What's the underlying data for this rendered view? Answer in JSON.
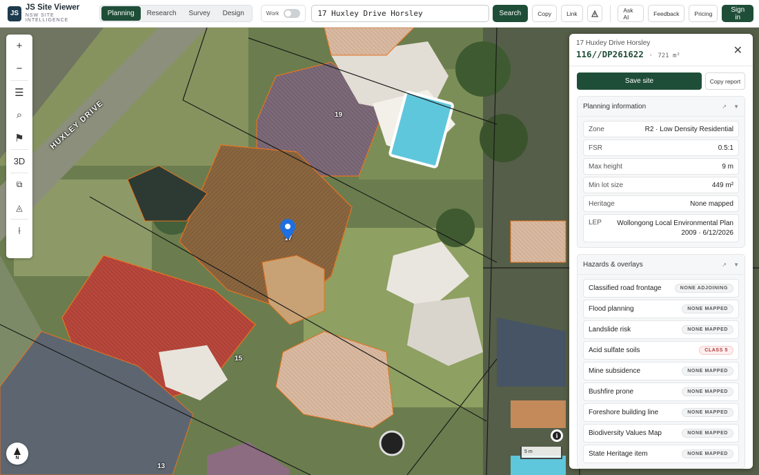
{
  "header": {
    "logo": "JS",
    "title": "JS Site Viewer",
    "subtitle": "NSW SITE INTELLIGENCE",
    "modes": [
      "Planning",
      "Research",
      "Survey",
      "Design"
    ],
    "active_mode": "Planning",
    "work_label": "Work",
    "search_value": "17 Huxley Drive Horsley",
    "search_button": "Search",
    "copy_button": "Copy",
    "link_button": "Link",
    "ask_ai": "Ask AI",
    "feedback": "Feedback",
    "pricing": "Pricing",
    "sign_in": "Sign in"
  },
  "map": {
    "street_name": "HUXLEY DRIVE",
    "lot_labels": [
      "19",
      "17",
      "15",
      "13"
    ],
    "scale_label": "5 m",
    "compass_label": "N",
    "toolbar": [
      "zoom-in",
      "zoom-out",
      "layers",
      "search",
      "flag",
      "3D",
      "copy",
      "measure-area",
      "measure-line"
    ],
    "toolbar_3d_label": "3D"
  },
  "panel": {
    "address": "17 Huxley Drive Horsley",
    "lot": "116//DP261622",
    "area_sep": "·",
    "area": "721 m²",
    "save_button": "Save site",
    "copy_report_button": "Copy report",
    "planning": {
      "title": "Planning information",
      "rows": [
        {
          "key": "Zone",
          "value": "R2 · Low Density Residential"
        },
        {
          "key": "FSR",
          "value": "0.5:1"
        },
        {
          "key": "Max height",
          "value": "9 m"
        },
        {
          "key": "Min lot size",
          "value": "449 m²"
        },
        {
          "key": "Heritage",
          "value": "None mapped"
        },
        {
          "key": "LEP",
          "value": "Wollongong Local Environmental Plan 2009 · 6/12/2026"
        }
      ]
    },
    "hazards": {
      "title": "Hazards & overlays",
      "rows": [
        {
          "key": "Classified road frontage",
          "value": "NONE ADJOINING",
          "status": "neutral"
        },
        {
          "key": "Flood planning",
          "value": "NONE MAPPED",
          "status": "neutral"
        },
        {
          "key": "Landslide risk",
          "value": "NONE MAPPED",
          "status": "neutral"
        },
        {
          "key": "Acid sulfate soils",
          "value": "CLASS 5",
          "status": "warn"
        },
        {
          "key": "Mine subsidence",
          "value": "NONE MAPPED",
          "status": "neutral"
        },
        {
          "key": "Bushfire prone",
          "value": "NONE MAPPED",
          "status": "neutral"
        },
        {
          "key": "Foreshore building line",
          "value": "NONE MAPPED",
          "status": "neutral"
        },
        {
          "key": "Biodiversity Values Map",
          "value": "NONE MAPPED",
          "status": "neutral"
        },
        {
          "key": "State Heritage item",
          "value": "NONE MAPPED",
          "status": "neutral"
        }
      ]
    }
  },
  "colors": {
    "accent": "#1f4e38",
    "warn": "#b13838",
    "lot_outline": "#e8731f"
  }
}
